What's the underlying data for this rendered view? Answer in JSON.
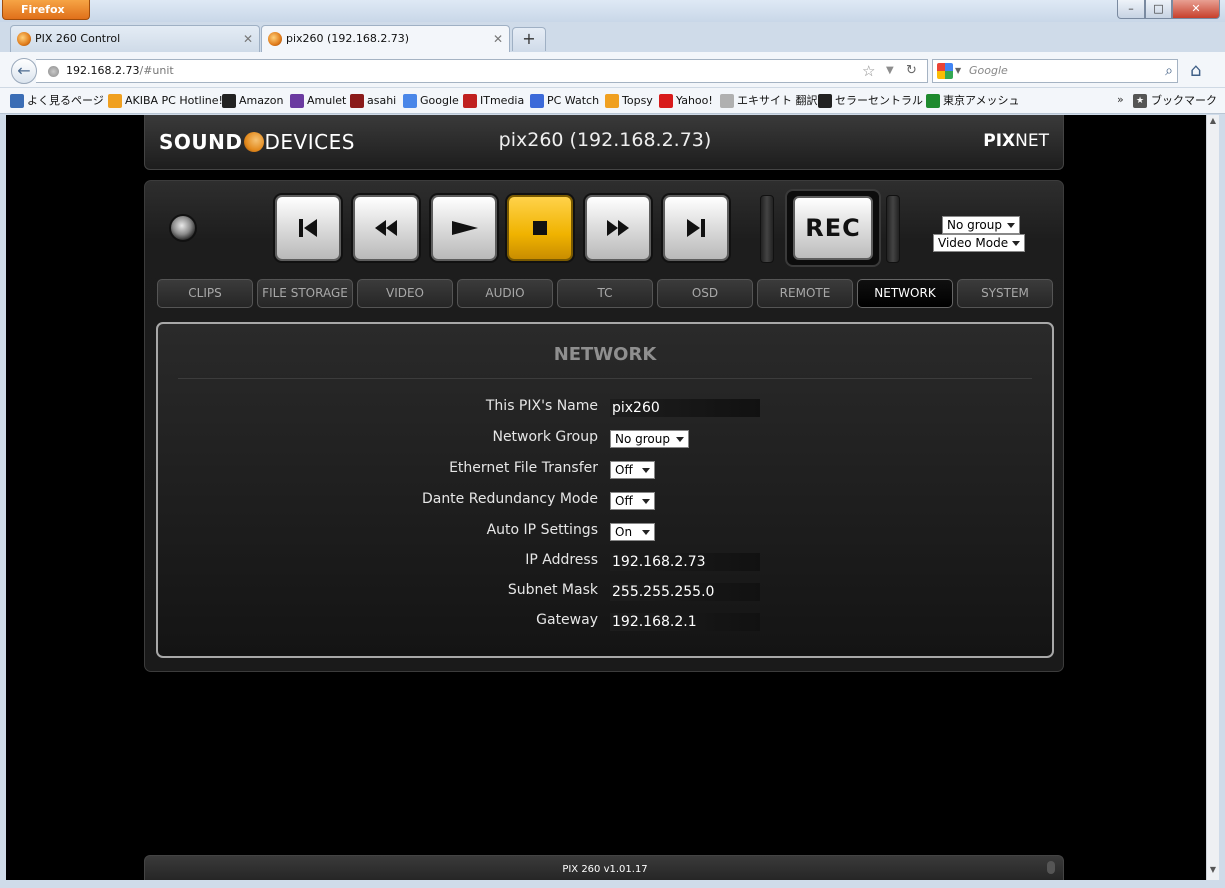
{
  "browser": {
    "app_button": "Firefox",
    "window_controls": {
      "minimize": "–",
      "maximize": "□",
      "close": "✕"
    },
    "tabs": [
      {
        "label": "PIX 260 Control",
        "active": false
      },
      {
        "label": "pix260 (192.168.2.73)",
        "active": true
      }
    ],
    "new_tab": "+",
    "url": {
      "host": "192.168.2.73",
      "path": "/#unit"
    },
    "search_placeholder": "Google",
    "bookmarks": [
      {
        "label": "よく見るページ",
        "icon_color": "#3b6db5"
      },
      {
        "label": "AKIBA PC Hotline!",
        "icon_color": "#f0a020"
      },
      {
        "label": "Amazon",
        "icon_color": "#222222"
      },
      {
        "label": "Amulet",
        "icon_color": "#6a3aa0"
      },
      {
        "label": "asahi",
        "icon_color": "#8a1a1a"
      },
      {
        "label": "Google",
        "icon_color": "#4a86e8"
      },
      {
        "label": "ITmedia",
        "icon_color": "#c0201f"
      },
      {
        "label": "PC Watch",
        "icon_color": "#3c6ad9"
      },
      {
        "label": "Topsy",
        "icon_color": "#f0a020"
      },
      {
        "label": "Yahoo!",
        "icon_color": "#d81b1b"
      },
      {
        "label": "エキサイト 翻訳",
        "icon_color": "#b0b0b0"
      },
      {
        "label": "セラーセントラル",
        "icon_color": "#222222"
      },
      {
        "label": "東京アメッシュ",
        "icon_color": "#1e8a2e"
      }
    ],
    "bookmarks_more": "»",
    "bookmarks_folder": "ブックマーク"
  },
  "app": {
    "brand_a": "SOUND",
    "brand_b": "DEVICES",
    "device_title": "pix260 (192.168.2.73)",
    "pixnet_a": "PIX",
    "pixnet_b": "NET",
    "rec_label": "REC",
    "group_select": "No group",
    "mode_select": "Video Mode",
    "tabs": [
      {
        "label": "CLIPS",
        "active": false
      },
      {
        "label": "FILE STORAGE",
        "active": false
      },
      {
        "label": "VIDEO",
        "active": false
      },
      {
        "label": "AUDIO",
        "active": false
      },
      {
        "label": "TC",
        "active": false
      },
      {
        "label": "OSD",
        "active": false
      },
      {
        "label": "REMOTE",
        "active": false
      },
      {
        "label": "NETWORK",
        "active": true
      },
      {
        "label": "SYSTEM",
        "active": false
      }
    ],
    "network": {
      "title": "NETWORK",
      "rows": [
        {
          "label": "This PIX's Name",
          "value": "pix260",
          "kind": "text"
        },
        {
          "label": "Network Group",
          "value": "No group",
          "kind": "select"
        },
        {
          "label": "Ethernet File Transfer",
          "value": "Off",
          "kind": "select"
        },
        {
          "label": "Dante Redundancy Mode",
          "value": "Off",
          "kind": "select"
        },
        {
          "label": "Auto IP Settings",
          "value": "On",
          "kind": "select"
        },
        {
          "label": "IP Address",
          "value": "192.168.2.73",
          "kind": "text"
        },
        {
          "label": "Subnet Mask",
          "value": "255.255.255.0",
          "kind": "text"
        },
        {
          "label": "Gateway",
          "value": "192.168.2.1",
          "kind": "text"
        }
      ]
    },
    "footer_version": "PIX 260 v1.01.17"
  }
}
